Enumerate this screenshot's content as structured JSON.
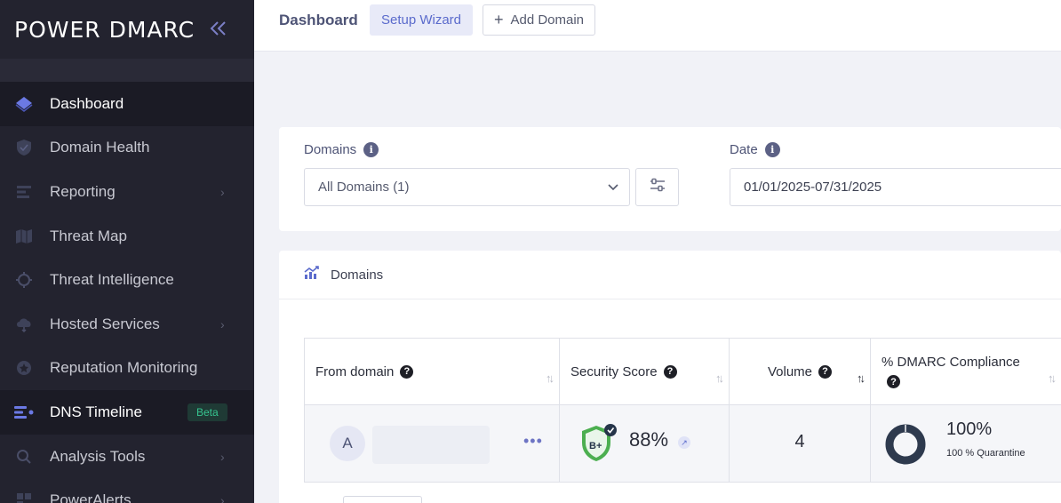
{
  "brand": {
    "logo_text": "POWER DMARC"
  },
  "sidebar": {
    "items": [
      {
        "label": "Dashboard",
        "icon": "layers-icon"
      },
      {
        "label": "Domain Health",
        "icon": "shield-icon"
      },
      {
        "label": "Reporting",
        "icon": "bars-icon"
      },
      {
        "label": "Threat Map",
        "icon": "map-icon"
      },
      {
        "label": "Threat Intelligence",
        "icon": "crosshair-icon"
      },
      {
        "label": "Hosted Services",
        "icon": "cloud-icon"
      },
      {
        "label": "Reputation Monitoring",
        "icon": "badge-icon"
      },
      {
        "label": "DNS Timeline",
        "icon": "timeline-icon",
        "badge": "Beta"
      },
      {
        "label": "Analysis Tools",
        "icon": "search-icon"
      },
      {
        "label": "PowerAlerts",
        "icon": "alerts-icon"
      }
    ]
  },
  "topbar": {
    "title": "Dashboard",
    "setup_wizard": "Setup Wizard",
    "add_domain": "Add Domain"
  },
  "filters": {
    "domains_label": "Domains",
    "domains_value": "All Domains (1)",
    "date_label": "Date",
    "date_value": "01/01/2025-07/31/2025"
  },
  "domains_card": {
    "title": "Domains",
    "columns": [
      "From domain",
      "Security Score",
      "Volume",
      "% DMARC Compliance"
    ],
    "row": {
      "avatar_letter": "A",
      "domain_name": "",
      "score_grade": "B+",
      "score_percent": "88%",
      "volume": "4",
      "compliance_percent": "100%",
      "compliance_sub": "100 % Quarantine"
    }
  },
  "colors": {
    "sidebar_bg": "#23232f",
    "accent": "#5b6bcc",
    "badge_green": "#36c48f",
    "shield_green": "#4caf50",
    "donut": "#2e3a4e"
  }
}
